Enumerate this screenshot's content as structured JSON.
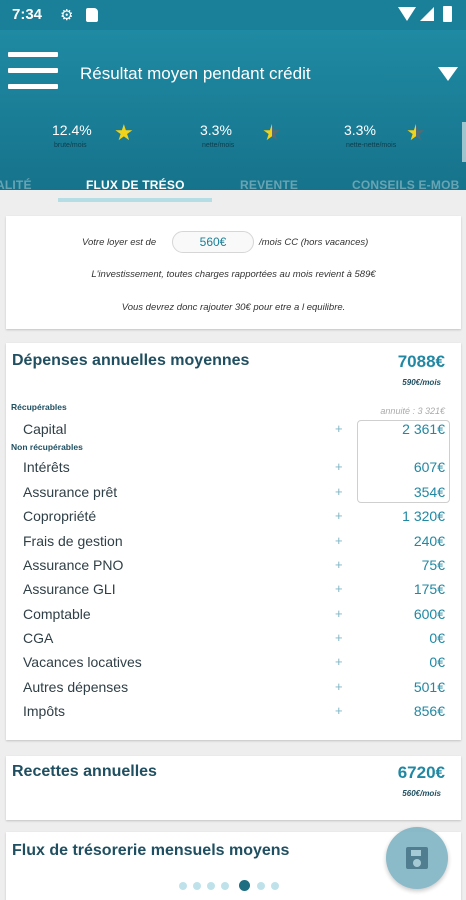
{
  "status_bar": {
    "time": "7:34"
  },
  "header": {
    "title": "Résultat moyen pendant crédit",
    "kpis": [
      {
        "value": "12.4%",
        "label": "brute/mois",
        "stars": "full"
      },
      {
        "value": "3.3%",
        "label": "nette/mois",
        "stars": "half"
      },
      {
        "value": "3.3%",
        "label": "nette-nette/mois",
        "stars": "half"
      }
    ],
    "tabs": [
      "ALITÉ",
      "FLUX DE TRÉSO",
      "REVENTE",
      "CONSEILS E-MOB"
    ],
    "active_tab": "FLUX DE TRÉSO"
  },
  "loyer": {
    "line1_pre": "Votre loyer est de",
    "loyer_value": "560€",
    "line1_post": "/mois CC (hors vacances)",
    "line2": "L'investissement, toutes charges rapportées au mois revient à 589€",
    "line3": "Vous devrez donc rajouter 30€ pour etre a l equilibre."
  },
  "depenses": {
    "title": "Dépenses annuelles moyennes",
    "total": "7088€",
    "per_month": "590€/mois",
    "section_recuperables": "Récupérables",
    "section_non_recuperables": "Non récupérables",
    "annuite_label": "annuité :",
    "annuite_value": "3 321€",
    "rows": [
      {
        "name": "Capital",
        "amount": "2 361€"
      },
      {
        "name": "Intérêts",
        "amount": "607€"
      },
      {
        "name": "Assurance prêt",
        "amount": "354€"
      },
      {
        "name": "Copropriété",
        "amount": "1 320€"
      },
      {
        "name": "Frais de gestion",
        "amount": "240€"
      },
      {
        "name": "Assurance PNO",
        "amount": "75€"
      },
      {
        "name": "Assurance GLI",
        "amount": "175€"
      },
      {
        "name": "Comptable",
        "amount": "600€"
      },
      {
        "name": "CGA",
        "amount": "0€"
      },
      {
        "name": "Vacances locatives",
        "amount": "0€"
      },
      {
        "name": "Autres dépenses",
        "amount": "501€"
      },
      {
        "name": "Impôts",
        "amount": "856€"
      }
    ],
    "plus_sign": "+"
  },
  "recettes": {
    "title": "Recettes annuelles",
    "total": "6720€",
    "per_month": "560€/mois"
  },
  "flux": {
    "title": "Flux de trésorerie mensuels moyens"
  },
  "pager": {
    "pages": 7,
    "active_index": 4
  },
  "colors": {
    "primary": "#1a7f98",
    "accent_text": "#2188a3",
    "title_text": "#1f4f60",
    "star": "#f2d31b"
  }
}
